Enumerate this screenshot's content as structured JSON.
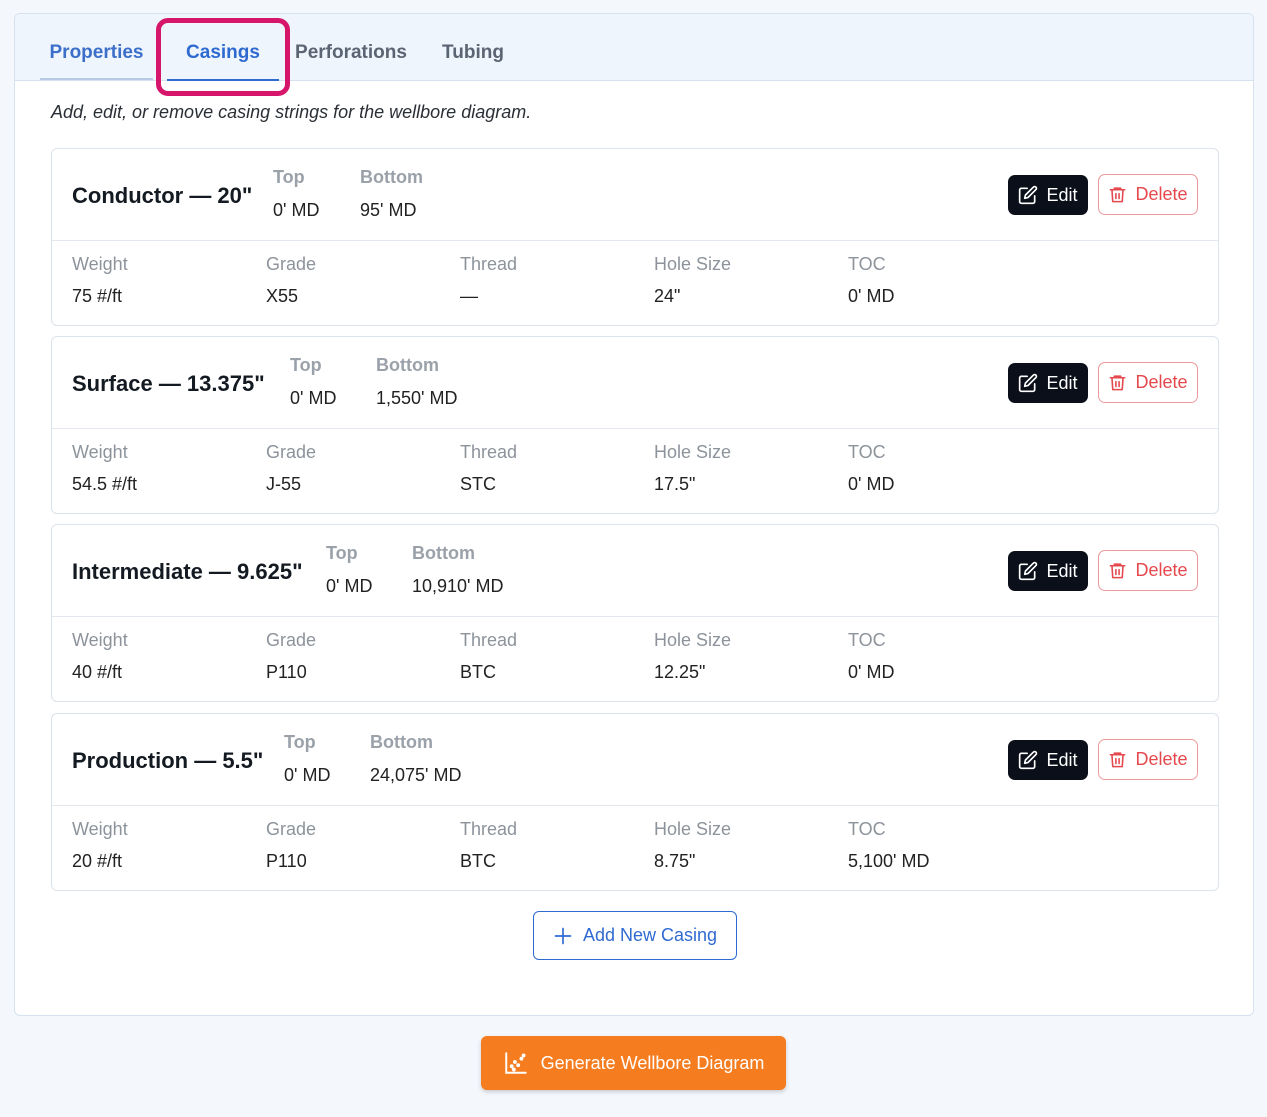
{
  "tabs": [
    "Properties",
    "Casings",
    "Perforations",
    "Tubing"
  ],
  "active_tab": "Casings",
  "intro": "Add, edit, or remove casing strings for the wellbore diagram.",
  "labels": {
    "top": "Top",
    "bottom": "Bottom",
    "weight": "Weight",
    "grade": "Grade",
    "thread": "Thread",
    "hole_size": "Hole Size",
    "toc": "TOC",
    "edit": "Edit",
    "delete": "Delete"
  },
  "casings": [
    {
      "title": "Conductor — 20\"",
      "top": "0' MD",
      "bottom": "95' MD",
      "weight": "75 #/ft",
      "grade": "X55",
      "thread": "—",
      "hole_size": "24\"",
      "toc": "0' MD"
    },
    {
      "title": "Surface — 13.375\"",
      "top": "0' MD",
      "bottom": "1,550' MD",
      "weight": "54.5 #/ft",
      "grade": "J-55",
      "thread": "STC",
      "hole_size": "17.5\"",
      "toc": "0' MD"
    },
    {
      "title": "Intermediate — 9.625\"",
      "top": "0' MD",
      "bottom": "10,910' MD",
      "weight": "40 #/ft",
      "grade": "P110",
      "thread": "BTC",
      "hole_size": "12.25\"",
      "toc": "0' MD"
    },
    {
      "title": "Production — 5.5\"",
      "top": "0' MD",
      "bottom": "24,075' MD",
      "weight": "20 #/ft",
      "grade": "P110",
      "thread": "BTC",
      "hole_size": "8.75\"",
      "toc": "5,100' MD"
    }
  ],
  "add_button": "Add New Casing",
  "generate_button": "Generate Wellbore Diagram",
  "colors": {
    "accent": "#2f6ad1",
    "danger": "#e5484d",
    "primary_dark": "#0b0f19",
    "orange": "#f57c1f",
    "highlight": "#d6166b"
  },
  "icons": {
    "edit": "edit-icon",
    "delete": "trash-icon",
    "add": "plus-icon",
    "generate": "chart-icon"
  }
}
